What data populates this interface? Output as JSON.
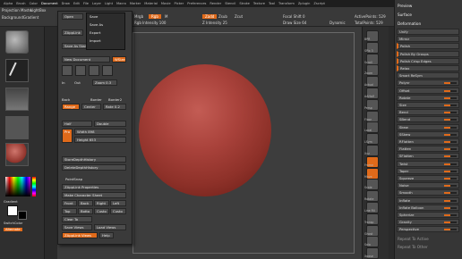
{
  "menubar": [
    "Alpha",
    "Brush",
    "Color",
    "Document",
    "Draw",
    "Edit",
    "File",
    "Layer",
    "Light",
    "Macro",
    "Marker",
    "Material",
    "Movie",
    "Picker",
    "Preferences",
    "Render",
    "Stencil",
    "Stroke",
    "Texture",
    "Tool",
    "Transform",
    "Zplugin",
    "Zscript"
  ],
  "top": {
    "proj_label": "Projection Master",
    "lightbox": "LightBox",
    "bgr_label": "BackgroundGradient",
    "bgr_value": "18",
    "mrgb": "Mrgb",
    "rgb": "Rgb",
    "m": "M",
    "zadd": "Zadd",
    "zsub": "Zsub",
    "zcut": "Zcut",
    "rgb_intensity": "Rgb Intensity 100",
    "z_intensity": "Z Intensity 25",
    "focal_shift": "Focal Shift 0",
    "draw_size": "Draw Size 64",
    "dynamic": "Dynamic",
    "active_points": "ActivePoints: 529",
    "total_points": "TotalPoints: 529"
  },
  "left": {
    "gradient": "Gradient",
    "switch_color": "SwitchColor",
    "alternate": "Alternate"
  },
  "document_menu": {
    "open": "Open",
    "save": "Save",
    "save_as": "Save As",
    "zappLink": "ZAppLink",
    "export": "Export",
    "import": "Import",
    "save_startup": "Save As Startup Doc",
    "new_document": "New Document",
    "wsize": "WSize",
    "in": "In",
    "out": "Out",
    "zoom": "Zoom 0.3",
    "back": "Back",
    "border": "Border",
    "border2": "Border2",
    "range": "Range",
    "center": "Center",
    "rate": "Rate 0.2",
    "half": "Half",
    "double": "Double",
    "pro": "Pro",
    "width": "Width 898",
    "height": "Height 653",
    "store_depth": "StoreDepthHistory",
    "delete_depth": "DeleteDepthHistory",
    "pointsnap": "PointSnap",
    "zapplink_props": "ZAppLink Properties",
    "make_character_sheet": "Make Character Sheet",
    "front": "Front",
    "back2": "Back",
    "right": "Right",
    "left": "Left",
    "top": "Top",
    "bottom": "Botto",
    "custom": "Custo",
    "custom2": "Custo",
    "clear_to": "Clear To",
    "save_views": "Save Views",
    "load_views": "Load Views",
    "zapplink_views": "ZAppLink Views",
    "help": "Help"
  },
  "right_shelf": [
    "BPR",
    "SPix 3",
    "Scroll",
    "Zoom",
    "Actual",
    "AAHalf",
    "Persp",
    "Floor",
    "Local",
    "LSym",
    "Xyz",
    "Frame",
    "Move",
    "Scale",
    "Rotate",
    "Line Fill",
    "Transp",
    "Ghost",
    "Solo",
    "Xpose"
  ],
  "right_panel": {
    "preview": "Preview",
    "surface": "Surface",
    "deformation": "Deformation",
    "rows": [
      "Unify",
      "Mirror",
      "Polish",
      "Polish By Groups",
      "Polish Crisp Edges",
      "Relax",
      "Smart ReSym",
      "Polynr",
      "Offset",
      "Rotate",
      "Size",
      "Bend",
      "SBend",
      "Skew",
      "SSkew",
      "RFlatten",
      "Flatten",
      "SFlatten",
      "Twist",
      "Taper",
      "Squeeze",
      "Noise",
      "Smooth",
      "Inflate",
      "Inflate Balloon",
      "Spherize",
      "Gravity",
      "Perspective"
    ],
    "repeat_active": "Repeat To Active",
    "repeat_other": "Repeat To Other"
  },
  "colors": {
    "accent": "#e06a1a",
    "sphere": "#a9423b"
  }
}
